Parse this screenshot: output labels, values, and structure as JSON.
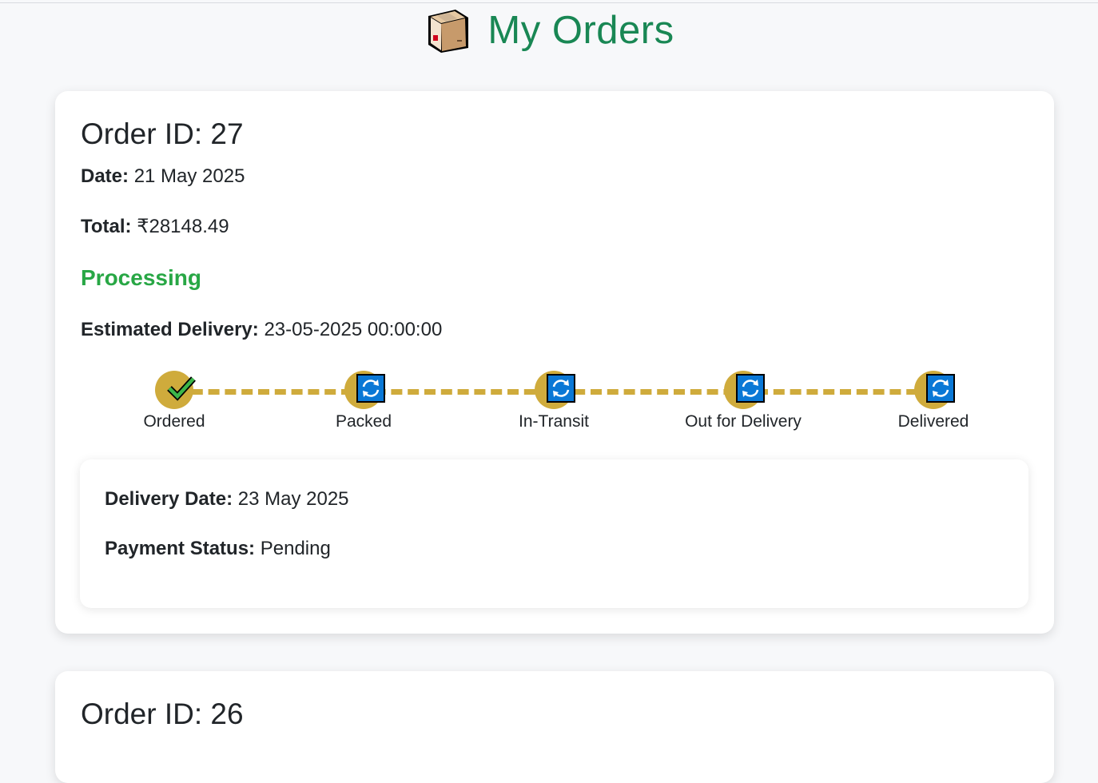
{
  "header": {
    "title": "My Orders",
    "icon": "package-box-icon"
  },
  "colors": {
    "title": "#198754",
    "status": "#28a745",
    "tracker": "#cfab3c",
    "pending_icon": "#0a78d6"
  },
  "orders": [
    {
      "id_label": "Order ID: 27",
      "date_label": "Date:",
      "date_value": "21 May 2025",
      "total_label": "Total:",
      "total_value": "₹28148.49",
      "status": "Processing",
      "eta_label": "Estimated Delivery:",
      "eta_value": "23-05-2025 00:00:00",
      "steps": [
        {
          "label": "Ordered",
          "state": "done",
          "icon": "checkmark-icon"
        },
        {
          "label": "Packed",
          "state": "pending",
          "icon": "refresh-icon"
        },
        {
          "label": "In-Transit",
          "state": "pending",
          "icon": "refresh-icon"
        },
        {
          "label": "Out for Delivery",
          "state": "pending",
          "icon": "refresh-icon"
        },
        {
          "label": "Delivered",
          "state": "pending",
          "icon": "refresh-icon"
        }
      ],
      "details": {
        "delivery_label": "Delivery Date:",
        "delivery_value": "23 May 2025",
        "payment_label": "Payment Status:",
        "payment_value": "Pending"
      }
    },
    {
      "id_label": "Order ID: 26"
    }
  ]
}
